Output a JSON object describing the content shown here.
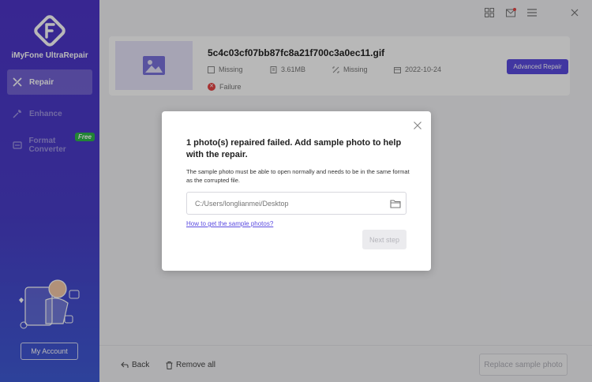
{
  "app": {
    "brand": "iMyFone UltraRepair"
  },
  "sidebar": {
    "items": [
      {
        "label": "Repair",
        "icon": "repair-icon"
      },
      {
        "label": "Enhance",
        "icon": "enhance-icon"
      },
      {
        "label": "Format Converter",
        "icon": "format-converter-icon"
      }
    ],
    "free_badge": "Free",
    "account_label": "My Account"
  },
  "titlebar": {
    "icons": [
      "grid-icon",
      "mail-icon",
      "menu-icon",
      "close-icon"
    ]
  },
  "file": {
    "name": "5c4c03cf07bb87fc8a21f700c3a0ec11.gif",
    "resolution": "Missing",
    "size": "3.61MB",
    "dimensions": "Missing",
    "date": "2022-10-24",
    "status": "Failure",
    "advanced_label": "Advanced Repair"
  },
  "footer": {
    "back_label": "Back",
    "remove_label": "Remove all",
    "replace_label": "Replace sample photo"
  },
  "dialog": {
    "title": "1 photo(s) repaired failed. Add sample photo to help with the repair.",
    "description": "The sample photo must be able to open normally and needs to be in the same format as the corrupted file.",
    "path_placeholder": "C:/Users/longlianmei/Desktop",
    "help_link": "How to get the sample photos?",
    "next_label": "Next step"
  },
  "colors": {
    "accent": "#5b4be0",
    "sidebar": "#4e35c9",
    "error": "#e64545",
    "free": "#2eb84a"
  }
}
